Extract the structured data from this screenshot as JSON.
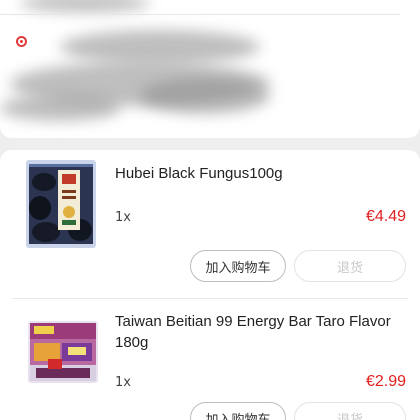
{
  "products": [
    {
      "name": "Hubei Black Fungus100g",
      "quantity": "1x",
      "price": "€4.49",
      "add_to_cart_label": "加入购物车",
      "return_label": "退货",
      "thumb_icon": "black-fungus-package"
    },
    {
      "name": "Taiwan Beitian 99 Energy Bar Taro Flavor 180g",
      "quantity": "1x",
      "price": "€2.99",
      "add_to_cart_label": "加入购物车",
      "return_label": "退货",
      "thumb_icon": "energy-bar-package"
    }
  ],
  "colors": {
    "price": "#e02020",
    "accent": "#e03b3b"
  }
}
